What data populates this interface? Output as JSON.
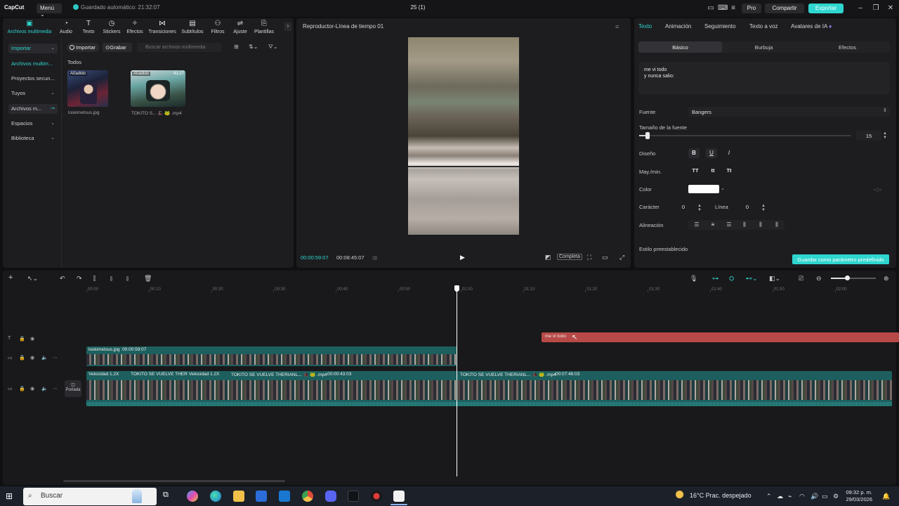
{
  "titlebar": {
    "app_name": "CapCut",
    "menu_label": "Menú",
    "autosave": "Guardado automático: 21:32:07",
    "project_title": "25 (1)",
    "pro_label": "Pro",
    "share_label": "Compartir",
    "export_label": "Exportar"
  },
  "toolbar": {
    "tabs": [
      "Archivos multimedia",
      "Audio",
      "Texto",
      "Stickers",
      "Efectos",
      "Transiciones",
      "Subtítulos",
      "Filtros",
      "Ajuste",
      "Plantillas"
    ],
    "active_index": 0
  },
  "sidebar": {
    "items": [
      "Importar",
      "Archivos multim...",
      "Proyectos secun...",
      "Tuyos",
      "Archivos m...",
      "Espacios",
      "Biblioteca"
    ]
  },
  "media": {
    "import_label": "Importar",
    "record_label": "Grabar",
    "search_placeholder": "Buscar archivos multimedia",
    "all_label": "Todos",
    "items": [
      {
        "tag": "Añadido",
        "time": "",
        "name": "loskimetsus.jpg"
      },
      {
        "tag": "Añadido",
        "time": "41:27",
        "name": "TOKITO S... 🎩 🐸 .mp4"
      }
    ]
  },
  "player": {
    "title": "Reproductor-Línea de tiempo 01",
    "current_time": "00:00:59:07",
    "total_time": "00:08:45:07",
    "complete_label": "Completa"
  },
  "properties": {
    "tabs": [
      "Texto",
      "Animación",
      "Seguimiento",
      "Texto a voz",
      "Avatares de IA"
    ],
    "active_tab": 0,
    "subtabs": [
      "Básico",
      "Burbuja",
      "Efectos"
    ],
    "active_subtab": 0,
    "text_content": "me vi todo\ny nunca salio:",
    "font_label": "Fuente",
    "font_value": "Bangers",
    "size_label": "Tamaño de la fuente",
    "size_value": "15",
    "size_fraction": 0.04,
    "design_label": "Diseño",
    "design_buttons": [
      "B",
      "U",
      "I"
    ],
    "case_label": "May./min.",
    "case_buttons": [
      "TT",
      "tt",
      "Tt"
    ],
    "color_label": "Color",
    "color_value": "#ffffff",
    "char_label": "Carácter",
    "char_value": "0",
    "line_label": "Línea",
    "line_value": "0",
    "align_label": "Alineación",
    "preset_label": "Estilo preestablecido",
    "save_preset_label": "Guardar como parámetro predefinido"
  },
  "timeline": {
    "ruler": [
      "00:00",
      "00:10",
      "00:20",
      "00:30",
      "00:40",
      "00:50",
      "01:00",
      "01:10",
      "01:20",
      "01:30",
      "01:40",
      "01:50",
      "02:00"
    ],
    "text_clip_label": "me vi todo",
    "image_clip_name": "loskimetsus.jpg",
    "image_clip_duration": "00:00:59:07",
    "main_clip_segments": [
      "Velocidad 1.2X",
      "TOKITO SE VUELVE THER",
      "Velocidad 1.2X",
      "TOKITO SE VUELVE THERIANL... 🎩 🐸 .mp4",
      "00:00:43:03",
      "TOKITO SE VUELVE THERIANL... 🎩 🐸 .mp4",
      "00:07:46:03"
    ],
    "cover_label": "Portada"
  },
  "taskbar": {
    "search_placeholder": "Buscar",
    "weather": "16°C  Prac. despejado",
    "time": "09:32 p. m.",
    "date": "29/03/2026"
  },
  "colors": {
    "accent": "#2ed6cf",
    "text_clip": "#b74a47",
    "video_clip": "#1d5f5e",
    "panel": "#1d1d20"
  }
}
